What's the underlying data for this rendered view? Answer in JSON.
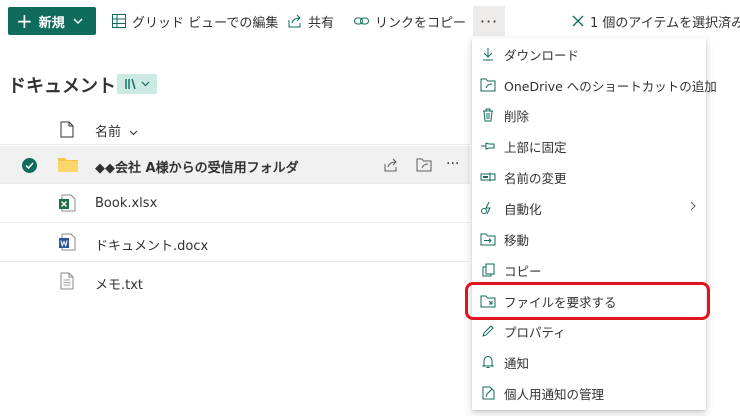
{
  "toolbar": {
    "new_label": "新規",
    "grid_edit_label": "グリッド ビューでの編集",
    "share_label": "共有",
    "copy_link_label": "リンクをコピー",
    "more_label": "···",
    "selection_label": "1 個のアイテムを選択済み",
    "accent_color": "#0f6b5c"
  },
  "library": {
    "title": "ドキュメント",
    "column_name": "名前",
    "files": [
      {
        "name": "◆◆会社 A様からの受信用フォルダ",
        "type": "folder-icon",
        "selected": true
      },
      {
        "name": "Book.xlsx",
        "type": "excel-icon",
        "selected": false
      },
      {
        "name": "ドキュメント.docx",
        "type": "word-icon",
        "selected": false
      },
      {
        "name": "メモ.txt",
        "type": "text-file-icon",
        "selected": false
      }
    ],
    "row_more": "···"
  },
  "context_menu": {
    "items": [
      {
        "label": "ダウンロード",
        "icon": "download-icon"
      },
      {
        "label": "OneDrive へのショートカットの追加",
        "icon": "shortcut-icon"
      },
      {
        "label": "削除",
        "icon": "delete-icon"
      },
      {
        "label": "上部に固定",
        "icon": "pin-icon"
      },
      {
        "label": "名前の変更",
        "icon": "rename-icon"
      },
      {
        "label": "自動化",
        "icon": "automate-icon",
        "submenu": true
      },
      {
        "label": "移動",
        "icon": "move-icon"
      },
      {
        "label": "コピー",
        "icon": "copy-icon"
      },
      {
        "label": "ファイルを要求する",
        "icon": "request-files-icon",
        "highlighted": true
      },
      {
        "label": "プロパティ",
        "icon": "properties-icon"
      },
      {
        "label": "通知",
        "icon": "alert-icon"
      },
      {
        "label": "個人用通知の管理",
        "icon": "manage-alerts-icon"
      }
    ],
    "highlight_color": "#e0141e"
  }
}
